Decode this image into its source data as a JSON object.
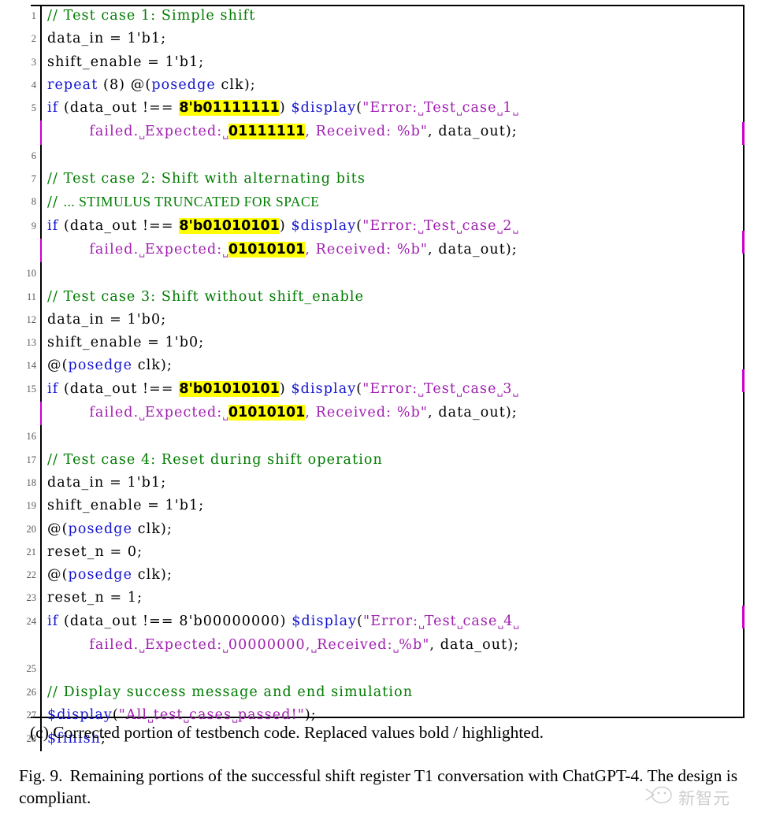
{
  "figure": {
    "subcaption": "(c) Corrected portion of testbench code. Replaced values bold / highlighted.",
    "caption_label": "Fig. 9.",
    "caption_line1": "Remaining portions of the successful shift register T1 conversation",
    "caption_line2": "with ChatGPT-4. The design is compliant."
  },
  "watermark": {
    "icon": "speech-bubble-face-icon",
    "text": "新智元"
  },
  "colors": {
    "comment": "#007c00",
    "keyword": "#1414cf",
    "string": "#a020b0",
    "highlight": "#ffff00",
    "changebar": "#cc00cc",
    "border": "#000000"
  },
  "code": {
    "language": "verilog",
    "line_numbers": [
      1,
      2,
      3,
      4,
      5,
      6,
      7,
      8,
      9,
      10,
      11,
      12,
      13,
      14,
      15,
      16,
      17,
      18,
      19,
      20,
      21,
      22,
      23,
      24,
      25,
      26,
      27,
      28
    ],
    "lines": [
      {
        "n": "1",
        "text": "// Test case 1: Simple shift"
      },
      {
        "n": "2",
        "text": "data_in = 1'b1;"
      },
      {
        "n": "3",
        "text": "shift_enable = 1'b1;"
      },
      {
        "n": "4",
        "text": "repeat (8) @(posedge clk);"
      },
      {
        "n": "5",
        "text": "if (data_out !== 8'b01111111) $display(\"Error: Test case 1 failed. Expected: 01111111, Received: %b\", data_out);",
        "highlighted": [
          "8'b01111111",
          "01111111"
        ],
        "changed": true
      },
      {
        "n": "6",
        "text": ""
      },
      {
        "n": "7",
        "text": "// Test case 2: Shift with alternating bits"
      },
      {
        "n": "8",
        "text": "// ... STIMULUS TRUNCATED FOR SPACE"
      },
      {
        "n": "9",
        "text": "if (data_out !== 8'b01010101) $display(\"Error: Test case 2 failed. Expected: 01010101, Received: %b\", data_out);",
        "highlighted": [
          "8'b01010101",
          "01010101"
        ],
        "changed": true
      },
      {
        "n": "10",
        "text": ""
      },
      {
        "n": "11",
        "text": "// Test case 3: Shift without shift_enable"
      },
      {
        "n": "12",
        "text": "data_in = 1'b0;"
      },
      {
        "n": "13",
        "text": "shift_enable = 1'b0;"
      },
      {
        "n": "14",
        "text": "@(posedge clk);"
      },
      {
        "n": "15",
        "text": "if (data_out !== 8'b01010101) $display(\"Error: Test case 3 failed. Expected: 01010101, Received: %b\", data_out);",
        "highlighted": [
          "8'b01010101",
          "01010101"
        ],
        "changed": true
      },
      {
        "n": "16",
        "text": ""
      },
      {
        "n": "17",
        "text": "// Test case 4: Reset during shift operation"
      },
      {
        "n": "18",
        "text": "data_in = 1'b1;"
      },
      {
        "n": "19",
        "text": "shift_enable = 1'b1;"
      },
      {
        "n": "20",
        "text": "@(posedge clk);"
      },
      {
        "n": "21",
        "text": "reset_n = 0;"
      },
      {
        "n": "22",
        "text": "@(posedge clk);"
      },
      {
        "n": "23",
        "text": "reset_n = 1;"
      },
      {
        "n": "24",
        "text": "if (data_out !== 8'b00000000) $display(\"Error: Test case 4 failed. Expected: 00000000, Received: %b\", data_out);",
        "highlighted": [],
        "changed": false
      },
      {
        "n": "25",
        "text": ""
      },
      {
        "n": "26",
        "text": "// Display success message and end simulation"
      },
      {
        "n": "27",
        "text": "$display(\"All test cases passed!\");"
      },
      {
        "n": "28",
        "text": "$finish;"
      }
    ]
  }
}
